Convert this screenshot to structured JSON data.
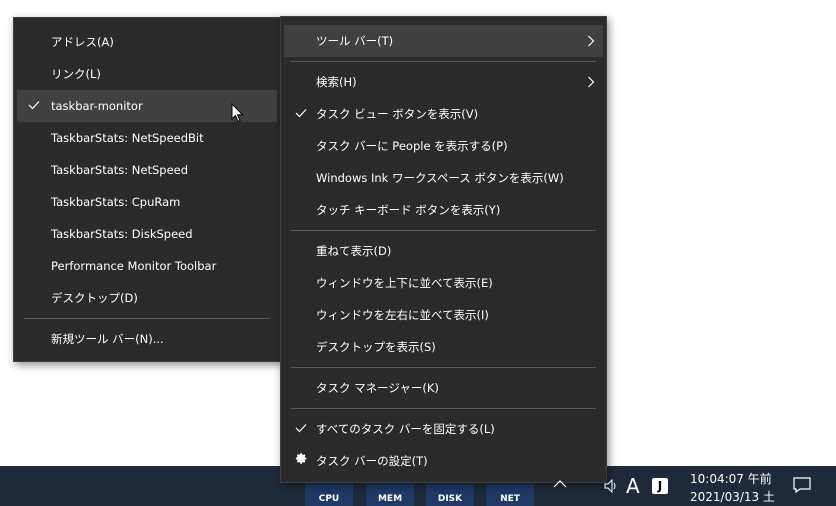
{
  "submenu": {
    "items": [
      {
        "label": "アドレス(A)",
        "checked": false
      },
      {
        "label": "リンク(L)",
        "checked": false
      },
      {
        "label": "taskbar-monitor",
        "checked": true,
        "hover": true
      },
      {
        "label": "TaskbarStats: NetSpeedBit",
        "checked": false
      },
      {
        "label": "TaskbarStats: NetSpeed",
        "checked": false
      },
      {
        "label": "TaskbarStats: CpuRam",
        "checked": false
      },
      {
        "label": "TaskbarStats: DiskSpeed",
        "checked": false
      },
      {
        "label": "Performance Monitor Toolbar",
        "checked": false
      },
      {
        "label": "デスクトップ(D)",
        "checked": false
      }
    ],
    "new_toolbar": "新規ツール バー(N)..."
  },
  "mainmenu": {
    "toolbar": "ツール バー(T)",
    "search": "検索(H)",
    "task_view": "タスク ビュー ボタンを表示(V)",
    "people": "タスク バーに People を表示する(P)",
    "ink": "Windows Ink ワークスペース ボタンを表示(W)",
    "touch_keyboard": "タッチ キーボード ボタンを表示(Y)",
    "cascade": "重ねて表示(D)",
    "stack": "ウィンドウを上下に並べて表示(E)",
    "side_by_side": "ウィンドウを左右に並べて表示(I)",
    "show_desktop": "デスクトップを表示(S)",
    "task_manager": "タスク マネージャー(K)",
    "lock_taskbar": "すべてのタスク バーを固定する(L)",
    "taskbar_settings": "タスク バーの設定(T)"
  },
  "taskbar": {
    "monitors": [
      "CPU",
      "MEM",
      "DISK",
      "NET"
    ],
    "ime": "A",
    "ime2": "J",
    "clock_time": "10:04:07 午前",
    "clock_date": "2021/03/13 土"
  },
  "icons": {
    "check": "check-icon",
    "arrow": "chevron-right-icon",
    "gear": "gear-icon",
    "tray_up": "chevron-up-icon",
    "speaker": "speaker-icon",
    "notify": "notification-icon"
  },
  "colors": {
    "menu_bg": "#2b2b2b",
    "hover_bg": "#414141",
    "separator": "#5a5a5a",
    "taskbar_bg": "#1f2a3a"
  }
}
